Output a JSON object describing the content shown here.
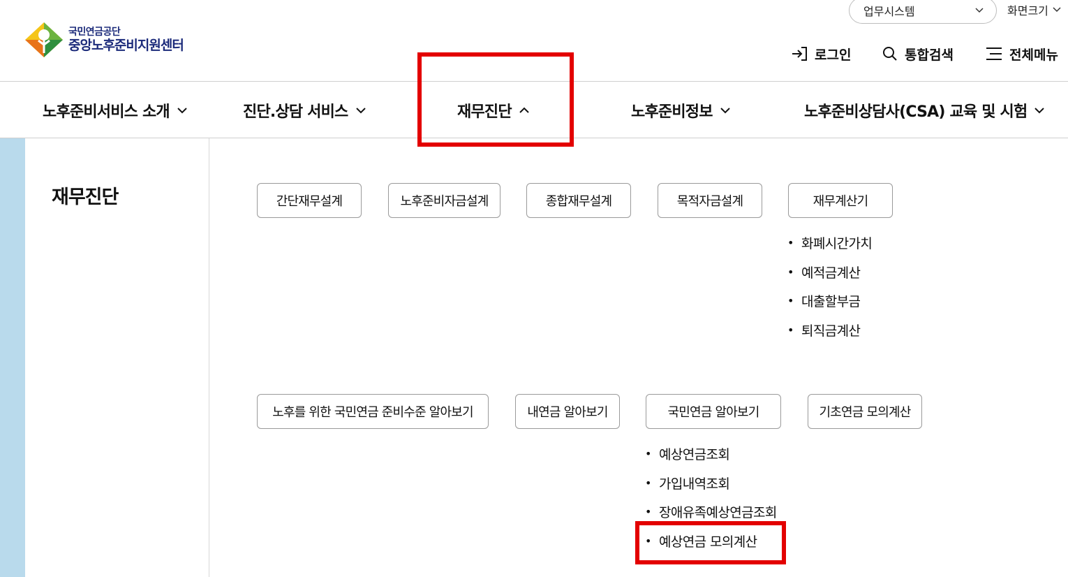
{
  "header": {
    "logo_org": "국민연금공단",
    "logo_center": "중앙노후준비지원센터",
    "system_select": "업무시스템",
    "screen_size": "화면크기",
    "login": "로그인",
    "search": "통합검색",
    "all_menu": "전체메뉴"
  },
  "gnb": {
    "items": [
      {
        "label": "노후준비서비스 소개",
        "expanded": false
      },
      {
        "label": "진단.상담 서비스",
        "expanded": false
      },
      {
        "label": "재무진단",
        "expanded": true
      },
      {
        "label": "노후준비정보",
        "expanded": false
      },
      {
        "label": "노후준비상담사(CSA) 교육 및 시험",
        "expanded": false
      }
    ]
  },
  "submenu": {
    "title": "재무진단",
    "row1": [
      "간단재무설계",
      "노후준비자금설계",
      "종합재무설계",
      "목적자금설계",
      "재무계산기"
    ],
    "calculator_items": [
      "화폐시간가치",
      "예적금계산",
      "대출할부금",
      "퇴직금계산"
    ],
    "row2": [
      "노후를 위한 국민연금 준비수준 알아보기",
      "내연금 알아보기",
      "국민연금 알아보기",
      "기초연금 모의계산"
    ],
    "pension_items": [
      "예상연금조회",
      "가입내역조회",
      "장애유족예상연금조회",
      "예상연금 모의계산"
    ]
  },
  "colors": {
    "highlight": "#e30000",
    "brand_navy": "#1b2a7a",
    "side_strip": "#b9daec"
  }
}
